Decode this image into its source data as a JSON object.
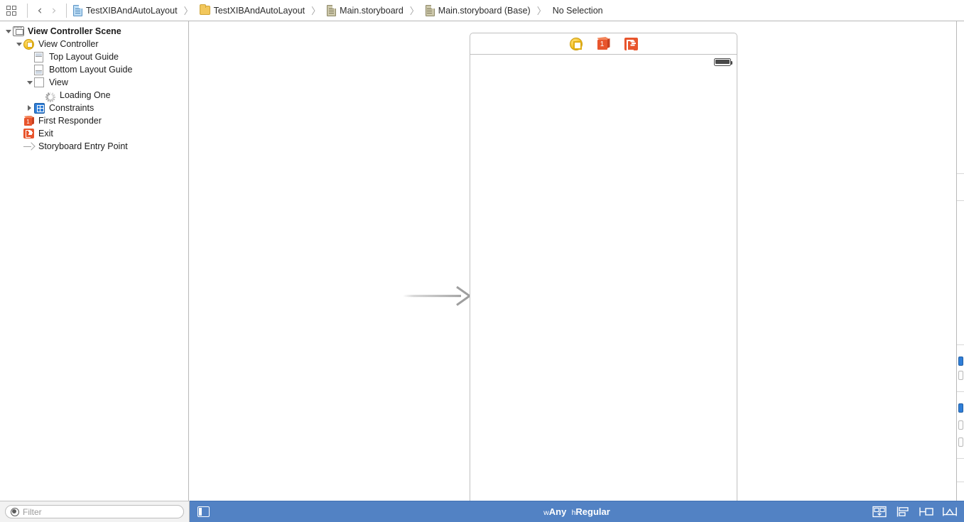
{
  "app": {
    "name": "Xcode Interface Builder",
    "accent_blue": "#5282c4",
    "selection_red": "#ff1a1a",
    "constraint_blue": "#2f7ed8",
    "vc_yellow": "#f3bf20",
    "exit_orange": "#e8552d"
  },
  "jumpbar": {
    "grid_icon": "grid-view-icon",
    "back_label": "‹",
    "forward_label": "›",
    "crumbs": [
      {
        "label": "TestXIBAndAutoLayout",
        "icon": "project-document-icon",
        "icon_kind": "doc-blue"
      },
      {
        "label": "TestXIBAndAutoLayout",
        "icon": "folder-icon",
        "icon_kind": "folder"
      },
      {
        "label": "Main.storyboard",
        "icon": "storyboard-document-icon",
        "icon_kind": "doc-gray"
      },
      {
        "label": "Main.storyboard (Base)",
        "icon": "storyboard-document-icon",
        "icon_kind": "doc-gray"
      },
      {
        "label": "No Selection",
        "icon": "none",
        "icon_kind": "none"
      }
    ],
    "separator_arrow": "〉"
  },
  "navigator": {
    "tree": [
      {
        "label": "View Controller Scene",
        "indent": 0,
        "disclosure": "open",
        "icon": "scene-icon",
        "bold": true
      },
      {
        "label": "View Controller",
        "indent": 1,
        "disclosure": "open",
        "icon": "view-controller-icon",
        "bold": false
      },
      {
        "label": "Top Layout Guide",
        "indent": 2,
        "disclosure": "none",
        "icon": "top-layout-guide-icon",
        "bold": false
      },
      {
        "label": "Bottom Layout Guide",
        "indent": 2,
        "disclosure": "none",
        "icon": "bottom-layout-guide-icon",
        "bold": false
      },
      {
        "label": "View",
        "indent": 2,
        "disclosure": "open",
        "icon": "view-icon",
        "bold": false
      },
      {
        "label": "Loading One",
        "indent": 3,
        "disclosure": "none",
        "icon": "activity-indicator-icon",
        "bold": false
      },
      {
        "label": "Constraints",
        "indent": 2,
        "disclosure": "closed",
        "icon": "constraints-icon",
        "bold": false
      },
      {
        "label": "First Responder",
        "indent": 1,
        "disclosure": "none",
        "icon": "first-responder-icon",
        "bold": false
      },
      {
        "label": "Exit",
        "indent": 1,
        "disclosure": "none",
        "icon": "exit-icon",
        "bold": false
      },
      {
        "label": "Storyboard Entry Point",
        "indent": 1,
        "disclosure": "none",
        "icon": "entry-point-arrow-icon",
        "bold": false
      }
    ]
  },
  "canvas": {
    "scene_dock": [
      {
        "name": "view-controller-dock-icon",
        "title": "View Controller"
      },
      {
        "name": "first-responder-dock-icon",
        "title": "First Responder"
      },
      {
        "name": "exit-dock-icon",
        "title": "Exit"
      }
    ],
    "device": {
      "status_bar_icon": "battery-icon",
      "selected_element": "Loading One",
      "selected_element_icon": "activity-indicator-icon"
    },
    "entry_point_arrow": "storyboard-entry-point-arrow"
  },
  "filter": {
    "placeholder": "Filter",
    "value": "",
    "icon": "filter-icon"
  },
  "statusbar": {
    "document_outline_toggle": "document-outline-toggle-icon",
    "trait_width_prefix": "w",
    "trait_width_value": "Any",
    "trait_height_prefix": "h",
    "trait_height_value": "Regular",
    "autolayout_buttons": [
      {
        "name": "stack-button",
        "label": "Stack"
      },
      {
        "name": "align-button",
        "label": "Align"
      },
      {
        "name": "pin-button",
        "label": "Pin"
      },
      {
        "name": "resolve-issues-button",
        "label": "Resolve Auto Layout Issues"
      }
    ]
  }
}
